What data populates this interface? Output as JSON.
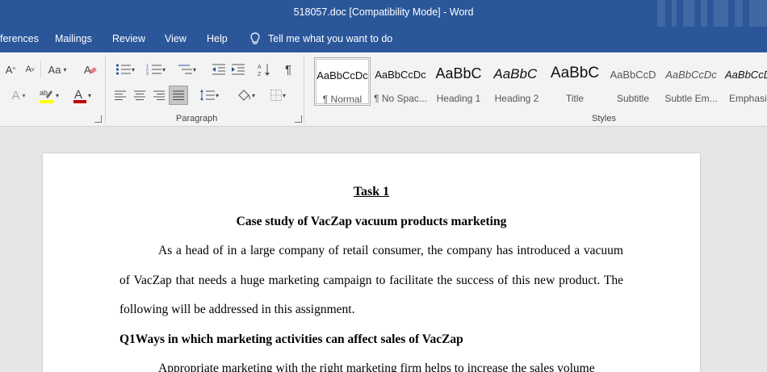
{
  "window": {
    "title": "518057.doc [Compatibility Mode]  -  Word"
  },
  "tabs": [
    {
      "label": "ferences"
    },
    {
      "label": "Mailings"
    },
    {
      "label": "Review"
    },
    {
      "label": "View"
    },
    {
      "label": "Help"
    }
  ],
  "tell_me": {
    "placeholder": "Tell me what you want to do"
  },
  "ribbon": {
    "font_group": {
      "grow_font": "A",
      "shrink_font": "A",
      "change_case": "Aa",
      "text_effects": "A",
      "font_color": "A",
      "font_color_hex": "#c00000",
      "highlight_hex": "#ffff00"
    },
    "paragraph_group": {
      "label": "Paragraph"
    },
    "styles_group": {
      "label": "Styles",
      "items": [
        {
          "preview": "AaBbCcDc",
          "name": "¶ Normal"
        },
        {
          "preview": "AaBbCcDc",
          "name": "¶ No Spac..."
        },
        {
          "preview": "AaBbC",
          "name": "Heading 1"
        },
        {
          "preview": "AaBbC ",
          "name": "Heading 2"
        },
        {
          "preview": "AaBbC",
          "name": "Title"
        },
        {
          "preview": "AaBbCcD",
          "name": "Subtitle"
        },
        {
          "preview": "AaBbCcDc",
          "name": "Subtle Em..."
        },
        {
          "preview": "AaBbCcDc",
          "name": "Emphasis"
        }
      ]
    }
  },
  "document": {
    "task_title": "Task 1",
    "subtitle": "Case study of VacZap vacuum products marketing",
    "para1": "As a head of in a large company of retail consumer, the company has introduced a vacuum of VacZap that needs a huge marketing campaign to facilitate the success of this new product. The following will be addressed in this assignment.",
    "q1_heading": "Q1Ways in which marketing activities can affect sales of VacZap",
    "para2": "Appropriate marketing with the right marketing firm helps to increase the sales volume"
  },
  "colors": {
    "accent": "#2b579a",
    "ribbon_bg": "#f3f3f3",
    "canvas_bg": "#e6e6e6"
  }
}
